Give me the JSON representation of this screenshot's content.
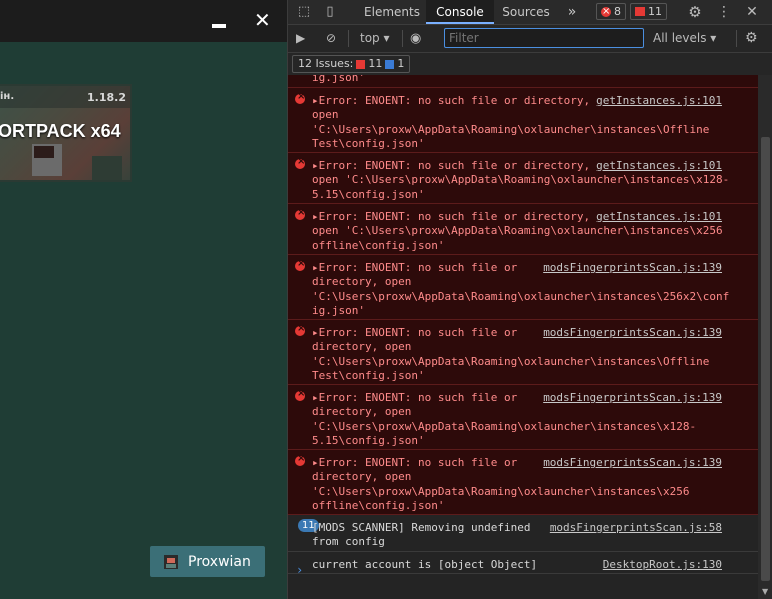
{
  "app": {
    "minimize_glyph": "—",
    "close_glyph": "✕",
    "card": {
      "left_label": "ін.",
      "version": "1.18.2",
      "title": "ORTPACK x64"
    },
    "user_button": {
      "name": "Proxwian"
    }
  },
  "devtools": {
    "tabs": [
      "Elements",
      "Console",
      "Sources"
    ],
    "active_tab": "Console",
    "more_tabs_glyph": "»",
    "error_count": "8",
    "issue_count_tab": "11",
    "toolbar": {
      "context": "top",
      "filter_placeholder": "Filter",
      "levels": "All levels"
    },
    "issues": {
      "label": "12 Issues:",
      "errors": "11",
      "infos": "1"
    },
    "messages": [
      {
        "type": "error",
        "lines": [
          "ig.json'"
        ],
        "source": ""
      },
      {
        "type": "error",
        "lines": [
          "▸Error: ENOENT: no such file or directory,",
          "open",
          "'C:\\Users\\proxw\\AppData\\Roaming\\oxlauncher\\instances\\Offline",
          "Test\\config.json'"
        ],
        "source": "getInstances.js:101"
      },
      {
        "type": "error",
        "lines": [
          "▸Error: ENOENT: no such file or directory,",
          "open 'C:\\Users\\proxw\\AppData\\Roaming\\oxlauncher\\instances\\x128-",
          "5.15\\config.json'"
        ],
        "source": "getInstances.js:101"
      },
      {
        "type": "error",
        "lines": [
          "▸Error: ENOENT: no such file or directory,",
          "open 'C:\\Users\\proxw\\AppData\\Roaming\\oxlauncher\\instances\\x256",
          "offline\\config.json'"
        ],
        "source": "getInstances.js:101"
      },
      {
        "type": "error",
        "lines": [
          "▸Error: ENOENT: no such file or",
          "directory, open",
          "'C:\\Users\\proxw\\AppData\\Roaming\\oxlauncher\\instances\\256x2\\conf",
          "ig.json'"
        ],
        "source": "modsFingerprintsScan.js:139"
      },
      {
        "type": "error",
        "lines": [
          "▸Error: ENOENT: no such file or",
          "directory, open",
          "'C:\\Users\\proxw\\AppData\\Roaming\\oxlauncher\\instances\\Offline",
          "Test\\config.json'"
        ],
        "source": "modsFingerprintsScan.js:139"
      },
      {
        "type": "error",
        "lines": [
          "▸Error: ENOENT: no such file or",
          "directory, open",
          "'C:\\Users\\proxw\\AppData\\Roaming\\oxlauncher\\instances\\x128-",
          "5.15\\config.json'"
        ],
        "source": "modsFingerprintsScan.js:139"
      },
      {
        "type": "error",
        "lines": [
          "▸Error: ENOENT: no such file or",
          "directory, open",
          "'C:\\Users\\proxw\\AppData\\Roaming\\oxlauncher\\instances\\x256",
          "offline\\config.json'"
        ],
        "source": "modsFingerprintsScan.js:139"
      },
      {
        "type": "info",
        "badge": "11",
        "lines": [
          "[MODS SCANNER] Removing undefined",
          "from config"
        ],
        "source": "modsFingerprintsScan.js:58"
      },
      {
        "type": "info",
        "lines": [
          "current account is [object Object]"
        ],
        "source": "DesktopRoot.js:130"
      }
    ],
    "prompt_glyph": "›"
  },
  "colors": {
    "error_bg": "#2d0a0a",
    "error_text": "#ff8b8b",
    "accent": "#7ab0ff",
    "app_bg": "#1f3d35",
    "user_button": "#3b6f77"
  }
}
